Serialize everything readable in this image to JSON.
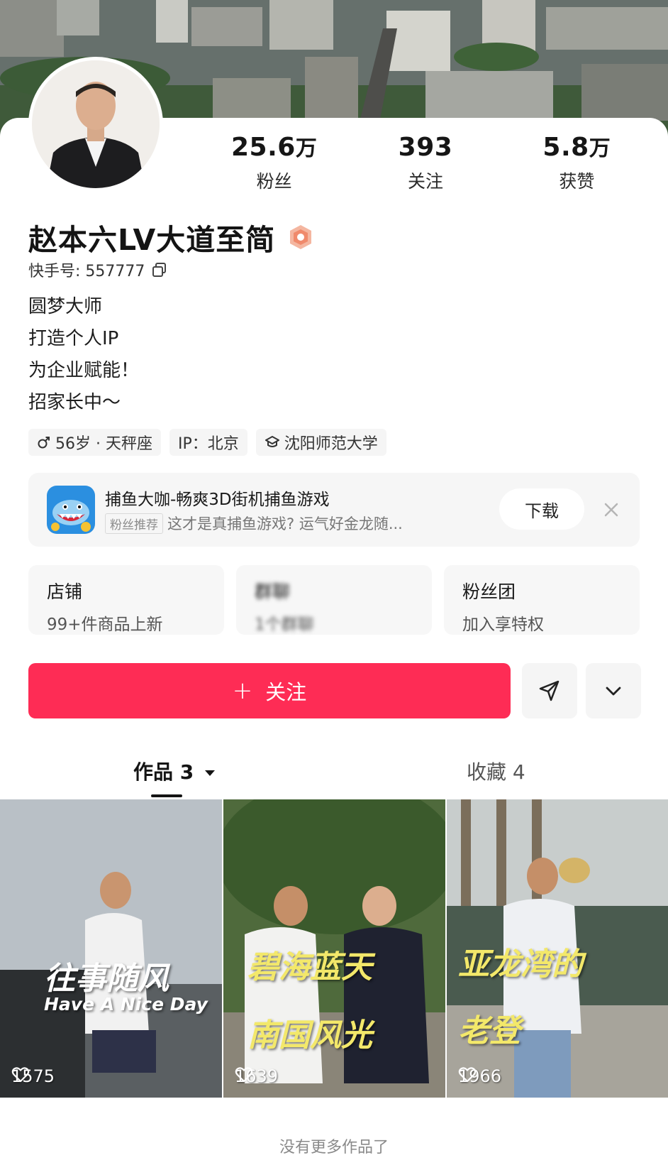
{
  "profile": {
    "display_name": "赵本六LV大道至简",
    "account_label": "快手号: 557777",
    "bio_lines": [
      "圆梦大师",
      "打造个人IP",
      "为企业赋能！",
      "招家长中～"
    ]
  },
  "stats": [
    {
      "value": "25.6",
      "unit": "万",
      "label": "粉丝"
    },
    {
      "value": "393",
      "unit": "",
      "label": "关注"
    },
    {
      "value": "5.8",
      "unit": "万",
      "label": "获赞"
    }
  ],
  "tags": [
    {
      "text": "56岁 · 天秤座",
      "icon": "male-icon"
    },
    {
      "text": "IP：北京",
      "icon": ""
    },
    {
      "text": "沈阳师范大学",
      "icon": "school-icon"
    }
  ],
  "ad": {
    "title": "捕鱼大咖-畅爽3D街机捕鱼游戏",
    "tag": "粉丝推荐",
    "subtitle": "这才是真捕鱼游戏? 运气好金龙随...",
    "button": "下载"
  },
  "features": [
    {
      "title": "店铺",
      "subtitle": "99+件商品上新"
    },
    {
      "title": "群聊",
      "subtitle": "1个群聊"
    },
    {
      "title": "粉丝团",
      "subtitle": "加入享特权"
    }
  ],
  "actions": {
    "follow_plus": "+",
    "follow_label": "关注"
  },
  "tabs": {
    "works": "作品 3",
    "favorites": "收藏 4"
  },
  "videos": [
    {
      "caption": "往事随风",
      "caption2": "Have A Nice Day",
      "likes": "1575"
    },
    {
      "caption": "碧海蓝天",
      "caption2": "南国风光",
      "likes": "1639"
    },
    {
      "caption": "亚龙湾的",
      "caption2": "老登",
      "likes": "1966"
    }
  ],
  "footer": {
    "end_text": "没有更多作品了"
  },
  "colors": {
    "accent": "#fe2c55",
    "caption_yellow": "#f3e86a"
  }
}
